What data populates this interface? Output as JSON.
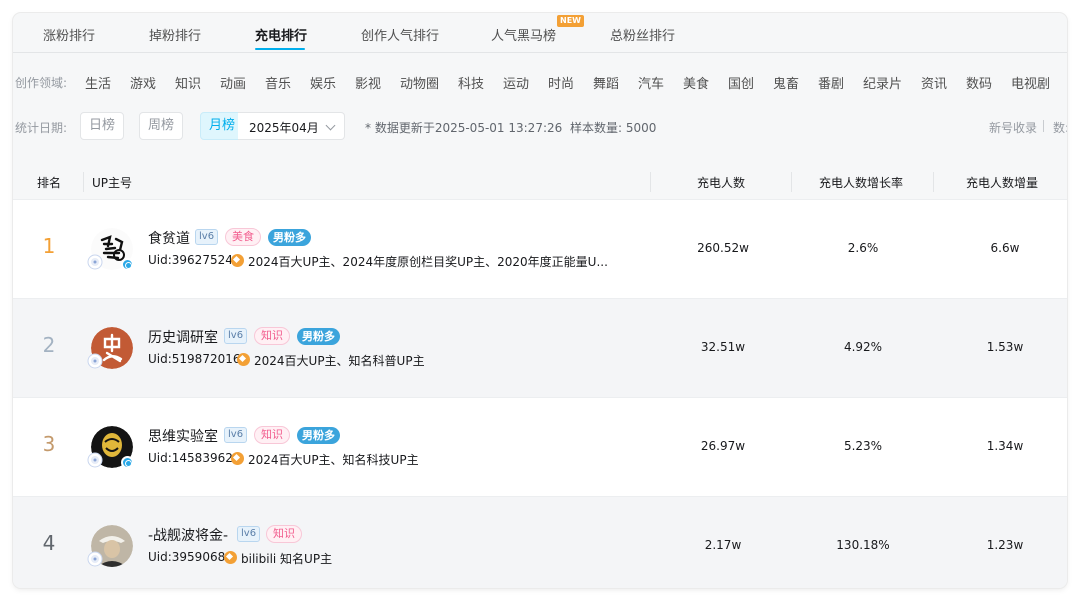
{
  "tabs": [
    {
      "label": "涨粉排行"
    },
    {
      "label": "掉粉排行"
    },
    {
      "label": "充电排行"
    },
    {
      "label": "创作人气排行"
    },
    {
      "label": "人气黑马榜"
    },
    {
      "label": "总粉丝排行"
    }
  ],
  "active_tab": "充电排行",
  "new_badge": "NEW",
  "categories": {
    "label": "创作领域:",
    "items": [
      "生活",
      "游戏",
      "知识",
      "动画",
      "音乐",
      "娱乐",
      "影视",
      "动物圈",
      "科技",
      "运动",
      "时尚",
      "舞蹈",
      "汽车",
      "美食",
      "国创",
      "鬼畜",
      "番剧",
      "纪录片",
      "资讯",
      "数码",
      "电视剧"
    ]
  },
  "stats": {
    "label": "统计日期:",
    "daily": "日榜",
    "weekly": "周榜",
    "monthly": "月榜",
    "month_value": "2025年04月",
    "update_info": "* 数据更新于2025-05-01 13:27:26",
    "sample": "样本数量: 5000",
    "right_a": "新号收录",
    "right_b": "数:"
  },
  "table": {
    "headers": {
      "rank": "排名",
      "up": "UP主号",
      "charge": "充电人数",
      "growth_rate": "充电人数增长率",
      "increase": "充电人数增量"
    },
    "rows": [
      {
        "rank": "1",
        "name": "食贫道",
        "level": "lv6",
        "category": "美食",
        "gender_tag": "男粉多",
        "uid": "Uid:39627524",
        "awards": "2024百大UP主、2024年度原创栏目奖UP主、2020年度正能量U...",
        "charge": "260.52w",
        "growth_rate": "2.6%",
        "increase": "6.6w"
      },
      {
        "rank": "2",
        "name": "历史调研室",
        "level": "lv6",
        "category": "知识",
        "gender_tag": "男粉多",
        "uid": "Uid:519872016",
        "awards": "2024百大UP主、知名科普UP主",
        "charge": "32.51w",
        "growth_rate": "4.92%",
        "increase": "1.53w"
      },
      {
        "rank": "3",
        "name": "思维实验室",
        "level": "lv6",
        "category": "知识",
        "gender_tag": "男粉多",
        "uid": "Uid:14583962",
        "awards": "2024百大UP主、知名科技UP主",
        "charge": "26.97w",
        "growth_rate": "5.23%",
        "increase": "1.34w"
      },
      {
        "rank": "4",
        "name": "-战舰波将金-",
        "level": "lv6",
        "category": "知识",
        "gender_tag": "",
        "uid": "Uid:3959068",
        "awards": "bilibili 知名UP主",
        "charge": "2.17w",
        "growth_rate": "130.18%",
        "increase": "1.23w"
      }
    ]
  },
  "colors": {
    "accent": "#00aeec",
    "rank1": "#f3a035",
    "rank2": "#a3b2c2",
    "rank3": "#c49a6c",
    "rank_other": "#61666d"
  }
}
